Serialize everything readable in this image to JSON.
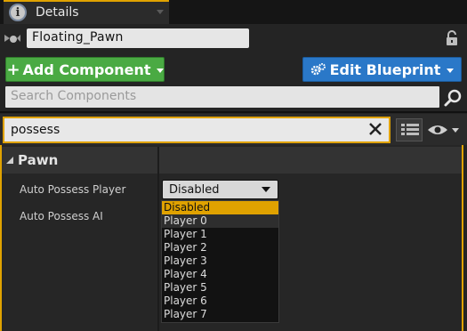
{
  "tab": {
    "title": "Details",
    "icon": "info-icon"
  },
  "actor": {
    "name": "Floating_Pawn"
  },
  "toolbar": {
    "add_component_label": "Add Component",
    "edit_blueprint_label": "Edit Blueprint"
  },
  "search": {
    "placeholder": "Search Components"
  },
  "filter": {
    "value": "possess"
  },
  "category": {
    "label": "Pawn"
  },
  "properties": [
    {
      "label": "Auto Possess Player",
      "value": "Disabled"
    },
    {
      "label": "Auto Possess AI"
    }
  ],
  "dropdown": {
    "options": [
      "Disabled",
      "Player 0",
      "Player 1",
      "Player 2",
      "Player 3",
      "Player 4",
      "Player 5",
      "Player 6",
      "Player 7"
    ],
    "selected": "Disabled"
  },
  "colors": {
    "accent": "#e0a200",
    "add_button": "#4aaa43",
    "edit_button": "#2a78c8"
  }
}
